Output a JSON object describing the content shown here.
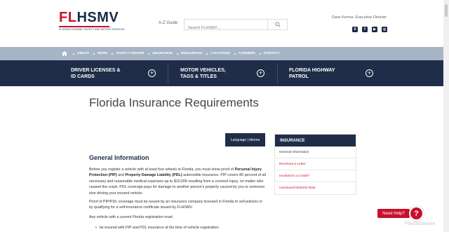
{
  "header": {
    "logo": {
      "fl": "FL",
      "hsmv": "HSMV",
      "tagline": "FLORIDA HIGHWAY SAFETY AND MOTOR VEHICLES"
    },
    "az_label": "A-Z Guide",
    "search_placeholder": "Search FLHSMV....",
    "director": "Dave Kerner, Executive Director",
    "social": [
      {
        "icon": "x-icon",
        "glyph": "X"
      },
      {
        "icon": "facebook-icon",
        "glyph": "f"
      },
      {
        "icon": "youtube-icon",
        "glyph": "▶"
      },
      {
        "icon": "instagram-icon",
        "glyph": "◎"
      }
    ]
  },
  "nav": {
    "items": [
      "ABOUT",
      "NEWS",
      "SAFETY CENTER",
      "INSURANCE",
      "RESOURCES",
      "LOCATIONS",
      "CAREERS",
      "CONTACT"
    ]
  },
  "categories": [
    {
      "line1": "DRIVER LICENSES &",
      "line2": "ID CARDS"
    },
    {
      "line1": "MOTOR VEHICLES,",
      "line2": "TAGS & TITLES"
    },
    {
      "line1": "FLORIDA HIGHWAY",
      "line2": "PATROL"
    }
  ],
  "main": {
    "title": "Florida Insurance Requirements",
    "language_button": "Language | Idioma",
    "heading": "General Information",
    "p1_a": "Before you register a vehicle with at least four wheels in Florida, you must show proof of ",
    "p1_b": "Personal Injury Protection (PIP)",
    "p1_c": " and ",
    "p1_d": "Property Damage Liability (PDL)",
    "p1_e": " automobile insurance. PIP covers 80 percent of all necessary and reasonable medical expenses up to $10,000 resulting from a covered injury, no matter who caused the crash. PDL coverage pays for damage to another person's property caused by you or someone else driving your insured vehicle.",
    "p2": "Proof of PIP/PDL coverage must be issued by an insurance company licensed in Florida to sell policies or by qualifying for a self-insurance certificate issued by FLHSMV.",
    "p3": "Any vehicle with a current Florida registration must:",
    "bullet1": "be insured with PIP and PDL insurance at the time of vehicle registration."
  },
  "sidebar": {
    "title": "INSURANCE",
    "items": [
      "General Information",
      "Received a Letter",
      "Involved in a Crash?",
      "Uninsured Motorist Rate"
    ]
  },
  "help": {
    "label": "Need Help?",
    "glyph": "?"
  },
  "watermark": "FlashMalware",
  "colors": {
    "navy": "#1f2d48",
    "red": "#c8102e",
    "nav_bg": "#a7b4c5"
  }
}
